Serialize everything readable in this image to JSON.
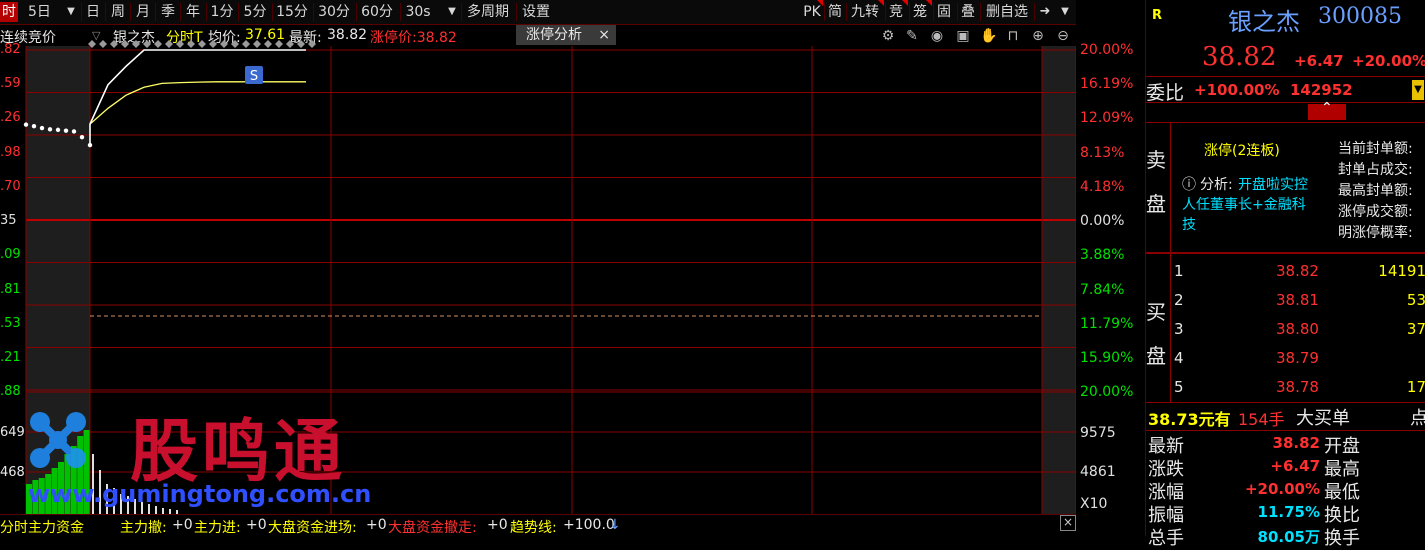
{
  "toolbar": {
    "items": [
      "时",
      "5日",
      "日",
      "周",
      "月",
      "季",
      "年",
      "1分",
      "5分",
      "15分",
      "30分",
      "60分",
      "30s",
      "多周期",
      "设置"
    ],
    "right_items": [
      "PK",
      "简",
      "九转",
      "竞",
      "笼",
      "固",
      "叠",
      "删自选"
    ]
  },
  "infobar": {
    "auction": "连续竞价",
    "stock_name": "银之杰",
    "mode": "分时T",
    "avg_label": "均价:",
    "avg_value": "37.61",
    "last_label": "最新:",
    "last_value": "38.82",
    "limit_label": "涨停价:38.82",
    "tag": "涨停分析",
    "tag_close": "×"
  },
  "axis": {
    "left_price": [
      ".82",
      ".59",
      ".26",
      ".98",
      ".70",
      "35",
      ".09",
      ".81",
      ".53",
      ".21",
      ".88"
    ],
    "right_pct_up": [
      "20.00%",
      "16.19%",
      "12.09%",
      "8.13%",
      "4.18%"
    ],
    "right_zero": "0.00%",
    "right_pct_down": [
      "3.88%",
      "7.84%",
      "11.79%",
      "15.90%",
      "20.00%"
    ],
    "left_vol": [
      "649",
      "468"
    ],
    "right_vol": [
      "9575",
      "4861"
    ],
    "vol_multiplier": "X10",
    "marker": "S"
  },
  "bottombar": {
    "label1": "分时主力资金",
    "label2": "主力撤:",
    "v2": "+0",
    "label3": "主力进:",
    "v3": "+0",
    "label4": "大盘资金进场:",
    "v4": "+0",
    "label5": "大盘资金撤走:",
    "v5": "+0",
    "label6": "趋势线:",
    "v6": "+100.0",
    "close": "×"
  },
  "watermark": {
    "brand": "股鸣通",
    "url": "www.gumingtong.com.cn"
  },
  "panel": {
    "r_badge": "R",
    "name": "银之杰",
    "code": "300085",
    "price": "38.82",
    "change": "+6.47",
    "change_pct": "+20.00%",
    "weibi_label": "委比",
    "weibi_pct": "+100.00%",
    "weibi_num": "142952",
    "sell_label1": "卖",
    "sell_label2": "盘",
    "limit_status": "涨停(2连板)",
    "analysis_prefix": "分析:",
    "analysis_text1": "开盘啦实控",
    "analysis_text2": "人任董事长+金融科",
    "analysis_text3": "技",
    "stats": [
      "当前封单额:",
      "封单占成交:",
      "最高封单额:",
      "涨停成交额:",
      "明涨停概率:"
    ],
    "buy_label1": "买",
    "buy_label2": "盘",
    "bids": [
      {
        "level": "1",
        "price": "38.82",
        "vol": "14191"
      },
      {
        "level": "2",
        "price": "38.81",
        "vol": "53"
      },
      {
        "level": "3",
        "price": "38.80",
        "vol": "37"
      },
      {
        "level": "4",
        "price": "38.79",
        "vol": ""
      },
      {
        "level": "5",
        "price": "38.78",
        "vol": "17"
      }
    ],
    "big_order_price": "38.73元有",
    "big_order_qty": "154手",
    "big_order_type": "大买单",
    "big_order_extra": "点",
    "quote": [
      {
        "label": "最新",
        "value": "38.82",
        "label2": "开盘"
      },
      {
        "label": "涨跌",
        "value": "+6.47",
        "label2": "最高"
      },
      {
        "label": "涨幅",
        "value": "+20.00%",
        "label2": "最低"
      },
      {
        "label": "振幅",
        "value": "11.75%",
        "label2": "换比"
      },
      {
        "label": "总手",
        "value": "80.05万",
        "label2": "换手"
      }
    ]
  },
  "colors": {
    "up": "#ff3030",
    "down": "#00e000",
    "price_line": "#ffffff",
    "avg_line": "#ffff00",
    "grid": "#8a0000",
    "accent_blue": "#6aa0ff"
  },
  "chart_data": {
    "type": "line",
    "title": "",
    "base_price": 32.35,
    "limit_price": 38.82,
    "ylim_pct": [
      -20,
      20
    ],
    "series": [
      {
        "name": "最新",
        "values": [
          35.98,
          35.92,
          35.85,
          35.8,
          35.78,
          35.75,
          35.72,
          35.5,
          35.2,
          36.0,
          37.5,
          38.2,
          38.82,
          38.82,
          38.82,
          38.82,
          38.82,
          38.82,
          38.82,
          38.82,
          38.82,
          38.82
        ]
      },
      {
        "name": "均价",
        "values": [
          null,
          null,
          null,
          null,
          null,
          null,
          null,
          null,
          null,
          36.0,
          36.6,
          37.1,
          37.4,
          37.55,
          37.58,
          37.6,
          37.61,
          37.61,
          37.61,
          37.61,
          37.61,
          37.61
        ]
      }
    ]
  }
}
